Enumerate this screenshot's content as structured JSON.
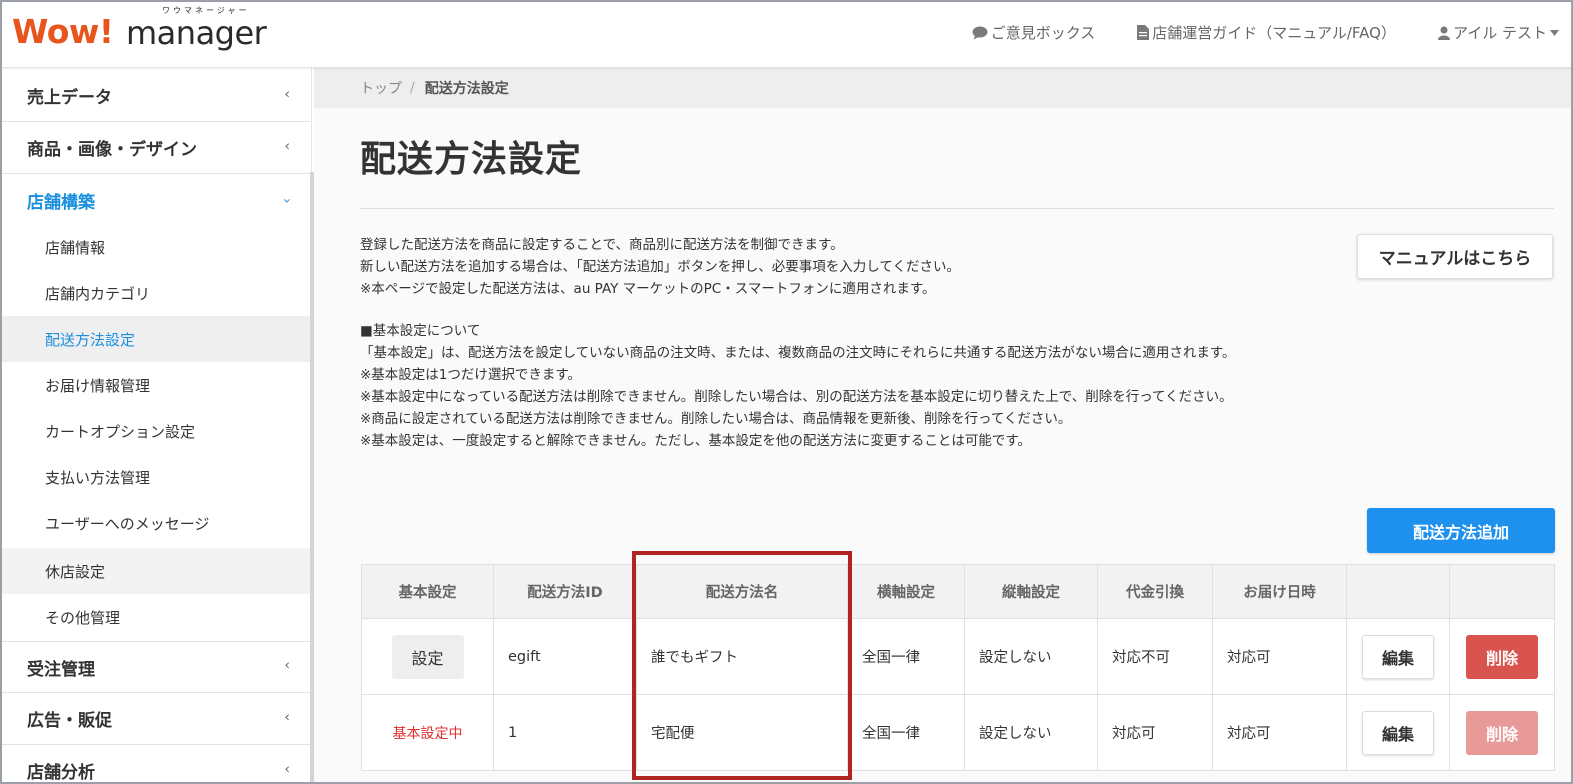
{
  "header": {
    "logo_wow": "Wow!",
    "logo_manager": "manager",
    "logo_kana": "ワウマネージャー",
    "nav": [
      {
        "icon": "comment-icon",
        "label": "ご意見ボックス"
      },
      {
        "icon": "document-icon",
        "label": "店舗運営ガイド（マニュアル/FAQ）"
      },
      {
        "icon": "user-icon",
        "label": "アイル テスト"
      }
    ]
  },
  "sidebar": {
    "sections": [
      {
        "label": "売上データ"
      },
      {
        "label": "商品・画像・デザイン"
      },
      {
        "label": "店舗構築"
      }
    ],
    "sub_items": [
      {
        "label": "店舗情報"
      },
      {
        "label": "店舗内カテゴリ"
      },
      {
        "label": "配送方法設定"
      },
      {
        "label": "お届け情報管理"
      },
      {
        "label": "カートオプション設定"
      },
      {
        "label": "支払い方法管理"
      },
      {
        "label": "ユーザーへのメッセージ"
      },
      {
        "label": "休店設定"
      },
      {
        "label": "その他管理"
      }
    ],
    "sections_after": [
      {
        "label": "受注管理"
      },
      {
        "label": "広告・販促"
      },
      {
        "label": "店舗分析"
      }
    ]
  },
  "breadcrumb": {
    "home": "トップ",
    "separator": "/",
    "current": "配送方法設定"
  },
  "page": {
    "title": "配送方法設定",
    "description": [
      "登録した配送方法を商品に設定することで、商品別に配送方法を制御できます。",
      "新しい配送方法を追加する場合は、「配送方法追加」ボタンを押し、必要事項を入力してください。",
      "※本ページで設定した配送方法は、au PAY マーケットのPC・スマートフォンに適用されます。"
    ],
    "basic_notes": [
      "■基本設定について",
      "「基本設定」は、配送方法を設定していない商品の注文時、または、複数商品の注文時にそれらに共通する配送方法がない場合に適用されます。",
      "※基本設定は1つだけ選択できます。",
      "※基本設定中になっている配送方法は削除できません。削除したい場合は、別の配送方法を基本設定に切り替えた上で、削除を行ってください。",
      "※商品に設定されている配送方法は削除できません。削除したい場合は、商品情報を更新後、削除を行ってください。",
      "※基本設定は、一度設定すると解除できません。ただし、基本設定を他の配送方法に変更することは可能です。"
    ],
    "manual_button": "マニュアルはこちら",
    "add_button": "配送方法追加"
  },
  "table": {
    "headers": [
      "基本設定",
      "配送方法ID",
      "配送方法名",
      "横軸設定",
      "縦軸設定",
      "代金引換",
      "お届け日時",
      "",
      ""
    ],
    "rows": [
      {
        "basic": "設定",
        "basic_is_default": false,
        "id": "egift",
        "name": "誰でもギフト",
        "horizontal": "全国一律",
        "vertical": "設定しない",
        "cod": "対応不可",
        "delivery": "対応可",
        "edit": "編集",
        "delete": "削除",
        "delete_enabled": true
      },
      {
        "basic": "基本設定中",
        "basic_is_default": true,
        "id": "1",
        "name": "宅配便",
        "horizontal": "全国一律",
        "vertical": "設定しない",
        "cod": "対応可",
        "delivery": "対応可",
        "edit": "編集",
        "delete": "削除",
        "delete_enabled": false
      }
    ]
  },
  "colors": {
    "accent_blue": "#1e90ee",
    "link_blue": "#1a8fdf",
    "logo_orange": "#e8541c",
    "delete_red": "#d9534f",
    "default_label_red": "#e03030",
    "highlight_red": "#b02424"
  }
}
